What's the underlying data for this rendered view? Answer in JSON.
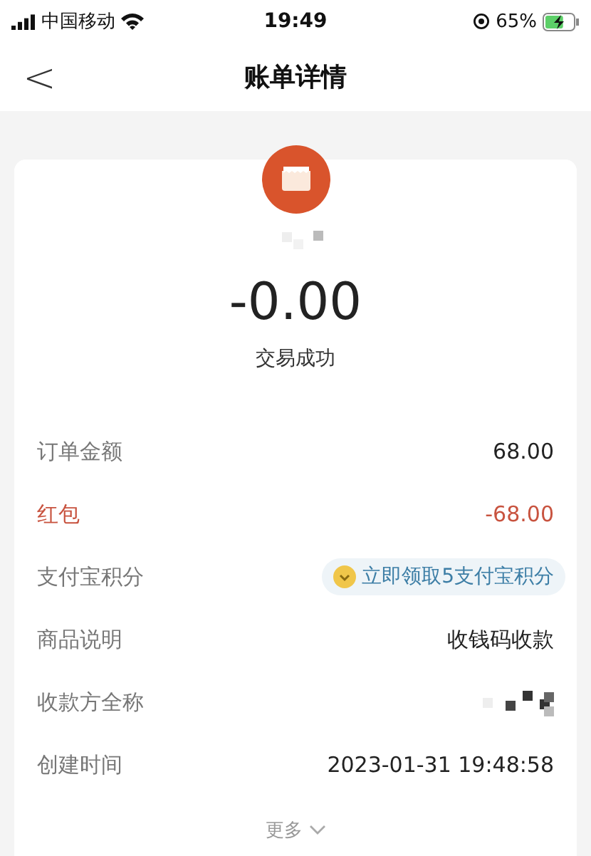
{
  "status_bar": {
    "carrier": "中国移动",
    "time": "19:49",
    "battery": "65%",
    "charging": true
  },
  "nav": {
    "back": "<",
    "title": "账单详情"
  },
  "summary": {
    "amount": "-0.00",
    "status": "交易成功"
  },
  "rows": [
    {
      "kind": "plain",
      "label": "订单金额",
      "value": "68.00"
    },
    {
      "kind": "red",
      "label": "红包",
      "value": "-68.00"
    },
    {
      "kind": "badge",
      "label": "支付宝积分",
      "value": "立即领取5支付宝积分"
    },
    {
      "kind": "plain",
      "label": "商品说明",
      "value": "收钱码收款"
    },
    {
      "kind": "mosaic",
      "label": "收款方全称"
    },
    {
      "kind": "plain",
      "label": "创建时间",
      "value": "2023-01-31 19:48:58"
    }
  ],
  "more": "更多"
}
